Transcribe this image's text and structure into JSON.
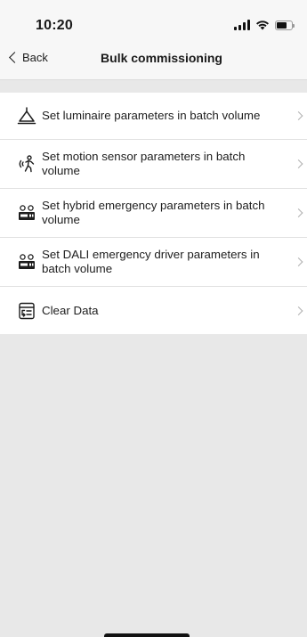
{
  "status_bar": {
    "time": "10:20",
    "icons": [
      "cellular-signal-icon",
      "wifi-icon",
      "battery-icon"
    ]
  },
  "nav": {
    "back_label": "Back",
    "title": "Bulk commissioning"
  },
  "menu": {
    "items": [
      {
        "label": "Set luminaire parameters in batch volume",
        "icon": "ceiling-lamp-icon"
      },
      {
        "label": "Set motion sensor parameters in batch volume",
        "icon": "motion-sensor-icon"
      },
      {
        "label": "Set hybrid emergency parameters in batch volume",
        "icon": "emergency-device-icon"
      },
      {
        "label": "Set DALI emergency driver parameters in batch volume",
        "icon": "emergency-driver-icon"
      },
      {
        "label": "Clear Data",
        "icon": "clear-data-icon"
      }
    ]
  },
  "colors": {
    "background": "#e8e8e8",
    "header": "#f7f7f7",
    "list": "#ffffff",
    "chevron": "#b0b0b0"
  }
}
